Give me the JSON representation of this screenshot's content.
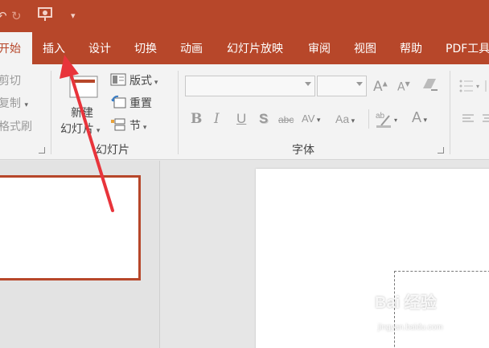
{
  "quick_access": {
    "undo_icon": "undo-icon",
    "redo_icon": "redo-icon",
    "slideshow_icon": "presenter-icon",
    "more_icon": "customize-caret-icon"
  },
  "tabs": [
    {
      "label": "开始"
    },
    {
      "label": "插入"
    },
    {
      "label": "设计"
    },
    {
      "label": "切换"
    },
    {
      "label": "动画"
    },
    {
      "label": "幻灯片放映"
    },
    {
      "label": "审阅"
    },
    {
      "label": "视图"
    },
    {
      "label": "帮助"
    },
    {
      "label": "PDF工具"
    }
  ],
  "clipboard": {
    "cut": "剪切",
    "copy": "复制",
    "format_painter": "格式刷"
  },
  "slides_group": {
    "new_slide_line1": "新建",
    "new_slide_line2": "幻灯片",
    "layout": "版式",
    "reset": "重置",
    "section": "节",
    "label": "幻灯片"
  },
  "font_group": {
    "label": "字体",
    "bold": "B",
    "italic": "I",
    "underline": "U",
    "shadow": "S",
    "strike": "abc",
    "spacing": "AV",
    "case": "Aa",
    "grow": "A",
    "shrink": "A",
    "color": "A"
  },
  "watermark": {
    "brand": "Bai 经验",
    "url": "jingyan.baidu.com"
  },
  "colors": {
    "accent": "#b7472a",
    "arrow": "#e8343b"
  }
}
